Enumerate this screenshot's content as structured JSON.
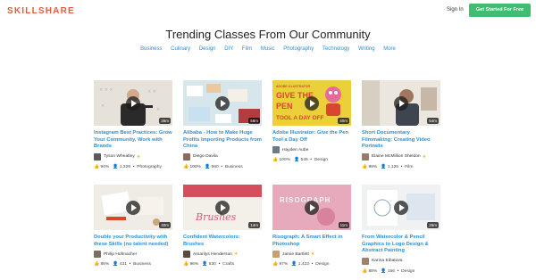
{
  "header": {
    "logo": "SKILLSHARE",
    "signin": "Sign In",
    "cta": "Get Started For Free"
  },
  "hero": {
    "title": "Trending Classes From Our Community"
  },
  "categories": [
    "Business",
    "Culinary",
    "Design",
    "DIY",
    "Film",
    "Music",
    "Photography",
    "Technology",
    "Writing",
    "More"
  ],
  "classes": [
    {
      "title": "Instagram Best Practices: Grow Your Community, Work with Brands",
      "duration": "36m",
      "author": "Tyson Wheatley",
      "rating": "94%",
      "students": "1,329",
      "category": "Photography"
    },
    {
      "title": "Alibaba - How to Make Huge Profits Importing Products from China",
      "duration": "58m",
      "author": "Diego Davila",
      "rating": "100%",
      "students": "660",
      "category": "Business"
    },
    {
      "title": "Adobe Illustrator: Give the Pen Tool a Day Off",
      "duration": "40m",
      "author": "Hayden Aube",
      "rating": "100%",
      "students": "545",
      "category": "Design"
    },
    {
      "title": "Short Documentary Filmmaking: Creating Video Portraits",
      "duration": "54m",
      "author": "Elaine McMillion Sheldon",
      "rating": "99%",
      "students": "1,125",
      "category": "Film"
    },
    {
      "title": "Double your Productivity with these Skills (no talent needed)",
      "duration": "40m",
      "author": "Philip Hofmacher",
      "rating": "86%",
      "students": "431",
      "category": "Business"
    },
    {
      "title": "Confident Watercolors: Brushes",
      "duration": "14m",
      "author": "Amarilys Henderson",
      "rating": "96%",
      "students": "530",
      "category": "Crafts"
    },
    {
      "title": "Risograph: A Smart Effect in Photoshop",
      "duration": "11m",
      "author": "Jamie Bartlett",
      "rating": "97%",
      "students": "1,423",
      "category": "Design"
    },
    {
      "title": "From Watercolor & Pencil Graphics to Logo Design & Abstract Painting",
      "duration": "26m",
      "author": "Karina Eibatova",
      "rating": "88%",
      "students": "156",
      "category": "Design"
    }
  ],
  "thumb_text": {
    "illustrator_label": "ADOBE ILLUSTRATOR",
    "illustrator_line1": "GIVE THE",
    "illustrator_line2": "PEN",
    "illustrator_line3": "TOOL A DAY OFF",
    "watercolor_word": "Brushes",
    "riso_word": "RISOGRAPH"
  },
  "colors": {
    "brand": "#e55c3a",
    "cta": "#3fbd71",
    "link": "#2c8fd6",
    "star": "#f5b623"
  }
}
